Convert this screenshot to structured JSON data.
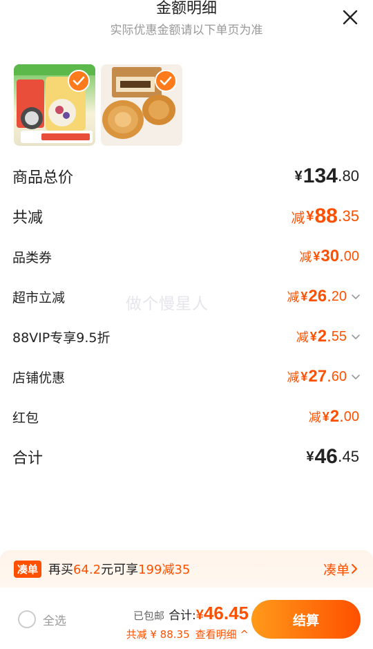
{
  "header": {
    "title": "金额明细",
    "subtitle": "实际优惠金额请以下单页为准"
  },
  "icons": {
    "close": "close-icon",
    "check": "checkmark-icon",
    "chevron": "chevron-down-icon",
    "arrow": "chevron-right-icon"
  },
  "colors": {
    "accent": "#ff5000",
    "accent_light": "#ff9a1a",
    "text": "#222222",
    "muted": "#999999"
  },
  "products": [
    {
      "name": "oatmeal-product",
      "selected": true
    },
    {
      "name": "bread-product",
      "selected": true
    }
  ],
  "rows": {
    "total": {
      "label": "商品总价",
      "yen": "¥",
      "int": "134",
      "dot": ".",
      "dec": "80"
    },
    "reduced": {
      "label": "共减",
      "prefix": "减",
      "yen": "¥",
      "int": "88",
      "dot": ".",
      "dec": "35"
    },
    "category_coupon": {
      "label": "品类券",
      "prefix": "减",
      "yen": "¥",
      "int": "30",
      "dot": ".",
      "dec": "00"
    },
    "supermarket": {
      "label": "超市立减",
      "prefix": "减",
      "yen": "¥",
      "int": "26",
      "dot": ".",
      "dec": "20"
    },
    "vip": {
      "label": "88VIP专享9.5折",
      "prefix": "减",
      "yen": "¥",
      "int": "2",
      "dot": ".",
      "dec": "55"
    },
    "shop": {
      "label": "店铺优惠",
      "prefix": "减",
      "yen": "¥",
      "int": "27",
      "dot": ".",
      "dec": "60"
    },
    "red_packet": {
      "label": "红包",
      "prefix": "减",
      "yen": "¥",
      "int": "2",
      "dot": ".",
      "dec": "00"
    },
    "sum": {
      "label": "合计",
      "yen": "¥",
      "int": "46",
      "dot": ".",
      "dec": "45"
    }
  },
  "watermark": "做个慢星人",
  "promo": {
    "tag": "凑单",
    "text_a": "再买",
    "amount": "64.2",
    "text_b": "元可享",
    "deal": "199减35",
    "action": "凑单"
  },
  "bottom": {
    "select_all": "全选",
    "free_shipping": "已包邮",
    "total_label": "合计:",
    "yen": "¥",
    "total_value": "46.45",
    "reduced": "共减 ¥ 88.35",
    "detail": "查看明细",
    "detail_arrow": "^",
    "checkout": "结算"
  }
}
